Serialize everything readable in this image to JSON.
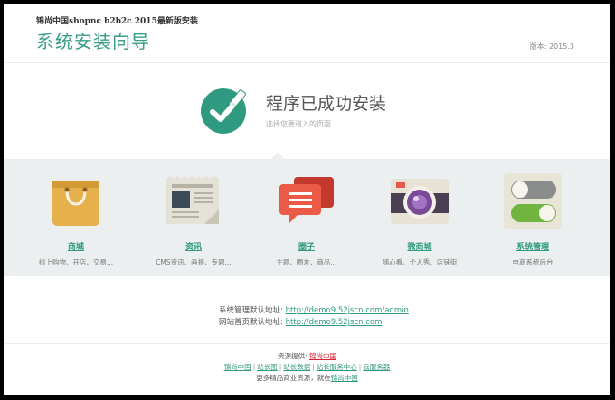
{
  "header": {
    "brand_line": "锦尚中国shopnc b2b2c 2015最新版安装",
    "title": "系统安装向导",
    "version": "版本: 2015.3"
  },
  "success": {
    "title": "程序已成功安装",
    "subtitle": "选择您要进入的页面"
  },
  "modules": [
    {
      "label": "商城",
      "desc": "线上购物、开店、交易...",
      "icon": "shopping-bag-icon"
    },
    {
      "label": "资讯",
      "desc": "CMS资讯、画报、专题...",
      "icon": "newspaper-icon"
    },
    {
      "label": "圈子",
      "desc": "主题、圈友、商品...",
      "icon": "chat-bubbles-icon"
    },
    {
      "label": "微商城",
      "desc": "随心看、个人秀、店铺街",
      "icon": "camera-icon"
    },
    {
      "label": "系统管理",
      "desc": "电商系统后台",
      "icon": "toggle-switches-icon"
    }
  ],
  "addresses": {
    "admin_label": "系统管理默认地址:",
    "admin_url": "http://demo9.52jscn.com/admin",
    "home_label": "网站首页默认地址:",
    "home_url": "http://demo9.52jscn.com"
  },
  "footer": {
    "provider_label": "资源提供:",
    "provider_link": "锦尚中国",
    "links": [
      "锦尚中国",
      "站长图",
      "站长数据",
      "站长服务中心",
      "云服务器"
    ],
    "more_text": "更多精品商业资源，就在",
    "more_link": "锦尚中国"
  },
  "colors": {
    "accent": "#2f9a7f",
    "band": "#eceff0",
    "provider_link": "#d23"
  }
}
